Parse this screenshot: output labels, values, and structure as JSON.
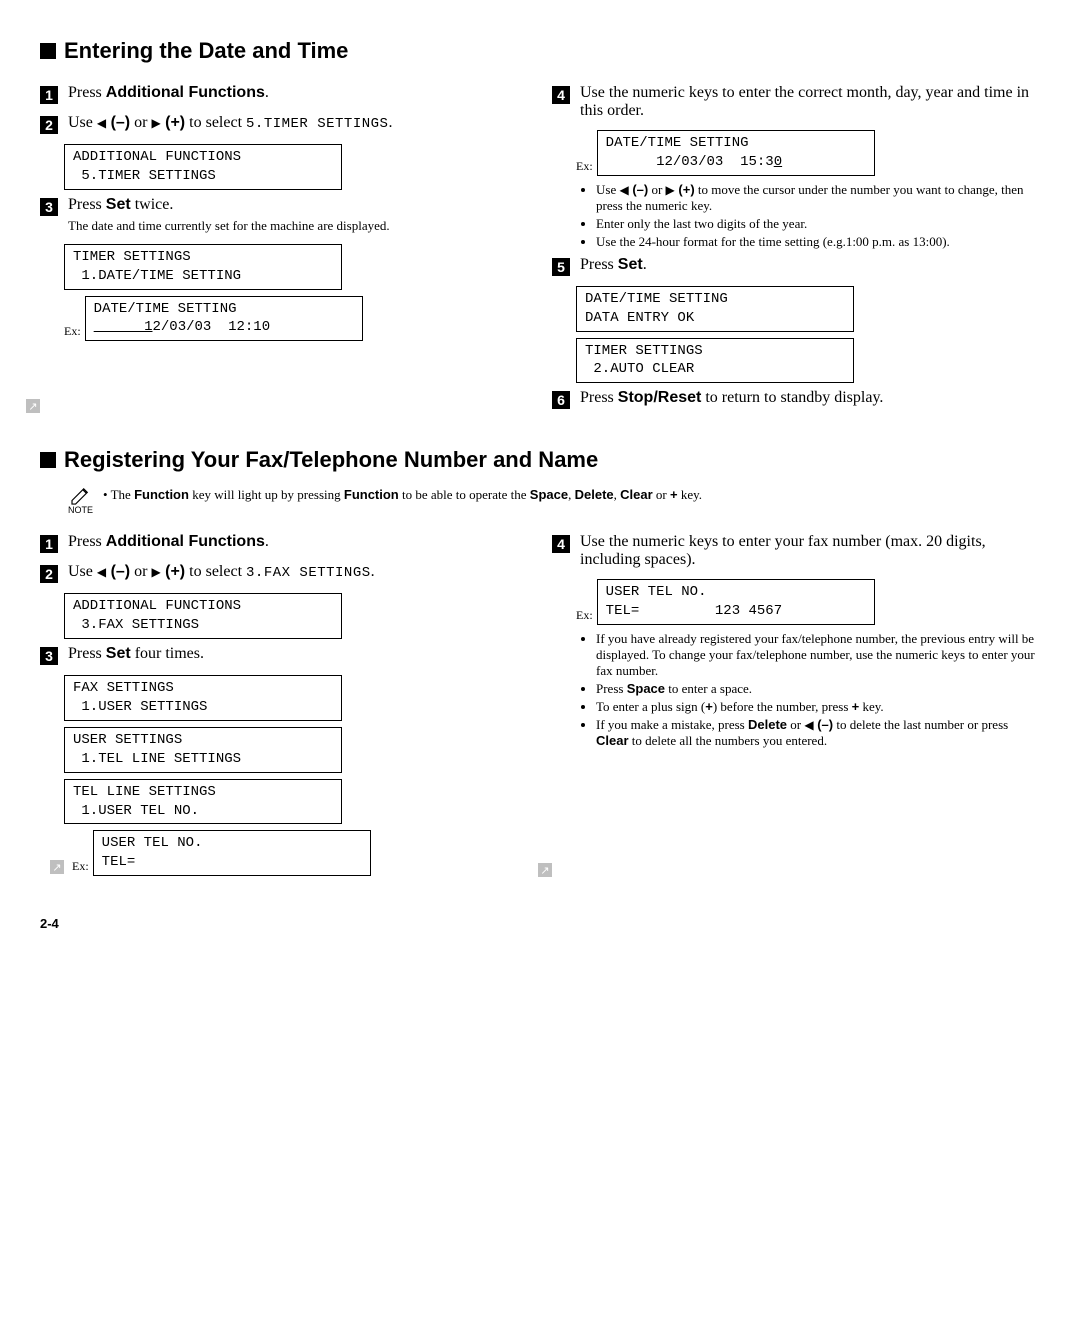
{
  "section1": {
    "title": "Entering the Date and Time",
    "left": {
      "step1": {
        "num": "1",
        "text_a": "Press ",
        "text_b": "Additional Functions",
        "text_c": "."
      },
      "step2": {
        "num": "2",
        "pre": "Use ",
        "minus": " (–)",
        "mid": " or ",
        "plus": " (+)",
        "post1": " to select ",
        "code": "5.TIMER SETTINGS",
        "post2": ".",
        "lcd": "ADDITIONAL FUNCTIONS\n 5.TIMER SETTINGS"
      },
      "step3": {
        "num": "3",
        "text_a": "Press ",
        "text_b": "Set",
        "text_c": " twice.",
        "sub": "The date and time currently set for the machine are displayed.",
        "lcd1": "TIMER SETTINGS\n 1.DATE/TIME SETTING",
        "ex_label": "Ex:",
        "lcd2_line1": "DATE/TIME SETTING",
        "lcd2_line2_a": "      1",
        "lcd2_line2_b": "2/03/03  12:10"
      }
    },
    "right": {
      "step4": {
        "num": "4",
        "text": "Use the numeric keys to enter the correct month, day, year and time in this order.",
        "ex_label": "Ex:",
        "lcd_line1": "DATE/TIME SETTING",
        "lcd_line2_a": "      12/03/03  15:3",
        "lcd_line2_b": "0",
        "b1_a": "Use ",
        "b1_minus": " (–)",
        "b1_mid": " or ",
        "b1_plus": " (+)",
        "b1_b": " to move the cursor under the number you want to change, then press the numeric key.",
        "b2": "Enter only the last two digits of the year.",
        "b3": "Use the 24-hour format for the time setting (e.g.1:00 p.m. as 13:00)."
      },
      "step5": {
        "num": "5",
        "text_a": "Press ",
        "text_b": "Set",
        "text_c": ".",
        "lcd1": "DATE/TIME SETTING\nDATA ENTRY OK",
        "lcd2": "TIMER SETTINGS\n 2.AUTO CLEAR"
      },
      "step6": {
        "num": "6",
        "text_a": "Press ",
        "text_b": "Stop/Reset",
        "text_c": " to return to standby display."
      }
    }
  },
  "section2": {
    "title": "Registering Your Fax/Telephone Number and Name",
    "note": {
      "label": "NOTE",
      "text_a": "The ",
      "text_b": "Function",
      "text_c": " key will light up by pressing ",
      "text_d": "Function",
      "text_e": " to be able to operate the ",
      "text_f": "Space",
      "text_g": ", ",
      "text_h": "Delete",
      "text_i": ", ",
      "text_j": "Clear",
      "text_k": " or ",
      "text_l": "+",
      "text_m": " key."
    },
    "left": {
      "step1": {
        "num": "1",
        "text_a": "Press ",
        "text_b": "Additional Functions",
        "text_c": "."
      },
      "step2": {
        "num": "2",
        "pre": "Use ",
        "minus": " (–)",
        "mid": " or ",
        "plus": " (+)",
        "post1": " to select ",
        "code": "3.FAX SETTINGS",
        "post2": ".",
        "lcd": "ADDITIONAL FUNCTIONS\n 3.FAX SETTINGS"
      },
      "step3": {
        "num": "3",
        "text_a": "Press ",
        "text_b": "Set",
        "text_c": " four times.",
        "lcd1": "FAX SETTINGS\n 1.USER SETTINGS",
        "lcd2": "USER SETTINGS\n 1.TEL LINE SETTINGS",
        "lcd3": "TEL LINE SETTINGS\n 1.USER TEL NO.",
        "ex_label": "Ex:",
        "lcd4": "USER TEL NO.\nTEL="
      }
    },
    "right": {
      "step4": {
        "num": "4",
        "text": "Use the numeric keys to enter your fax number (max. 20 digits, including spaces).",
        "ex_label": "Ex:",
        "lcd": "USER TEL NO.\nTEL=         123 4567",
        "b1": "If you have already registered your fax/telephone number, the previous entry will be displayed. To change your fax/telephone number, use the numeric keys to enter your fax number.",
        "b2_a": "Press ",
        "b2_b": "Space",
        "b2_c": " to enter a space.",
        "b3_a": "To enter a plus sign (",
        "b3_b": "+",
        "b3_c": ") before the number, press ",
        "b3_d": "+",
        "b3_e": " key.",
        "b4_a": "If you make a mistake, press ",
        "b4_b": "Delete",
        "b4_c": " or ",
        "b4_minus": " (–)",
        "b4_d": " to delete the last number or press ",
        "b4_e": "Clear",
        "b4_f": " to delete all the numbers you entered."
      }
    }
  },
  "page_number": "2-4"
}
